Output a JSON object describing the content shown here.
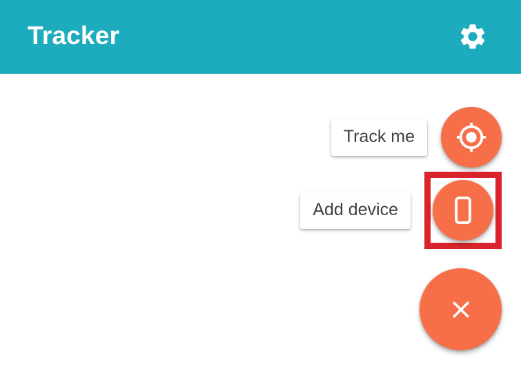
{
  "app": {
    "title": "Tracker",
    "bar_color": "#1DACBE",
    "accent_color": "#F66F48",
    "highlight_color": "#D8242A",
    "label_text_color": "#404040"
  },
  "appbar": {
    "title": "Tracker",
    "settings_icon": "gear-icon"
  },
  "fab_menu": {
    "expanded": true,
    "actions": [
      {
        "label": "Track me",
        "icon": "my-location-icon",
        "highlighted": false
      },
      {
        "label": "Add device",
        "icon": "smartphone-icon",
        "highlighted": true
      }
    ],
    "close": {
      "icon": "close-icon",
      "label": "Close menu"
    }
  }
}
